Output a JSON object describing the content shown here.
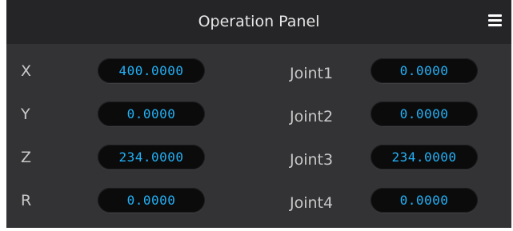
{
  "panel": {
    "title": "Operation Panel",
    "menu_icon": "hamburger-menu-icon"
  },
  "cartesian": [
    {
      "label": "X",
      "value": "400.0000"
    },
    {
      "label": "Y",
      "value": "0.0000"
    },
    {
      "label": "Z",
      "value": "234.0000"
    },
    {
      "label": "R",
      "value": "0.0000"
    }
  ],
  "joints": [
    {
      "label": "Joint1",
      "value": "0.0000"
    },
    {
      "label": "Joint2",
      "value": "0.0000"
    },
    {
      "label": "Joint3",
      "value": "234.0000"
    },
    {
      "label": "Joint4",
      "value": "0.0000"
    }
  ],
  "colors": {
    "panel_bg": "#333335",
    "header_bg": "#252527",
    "value_text": "#22b0f5",
    "value_bg": "#0b0b0c",
    "label_text": "#c8c8c8"
  }
}
